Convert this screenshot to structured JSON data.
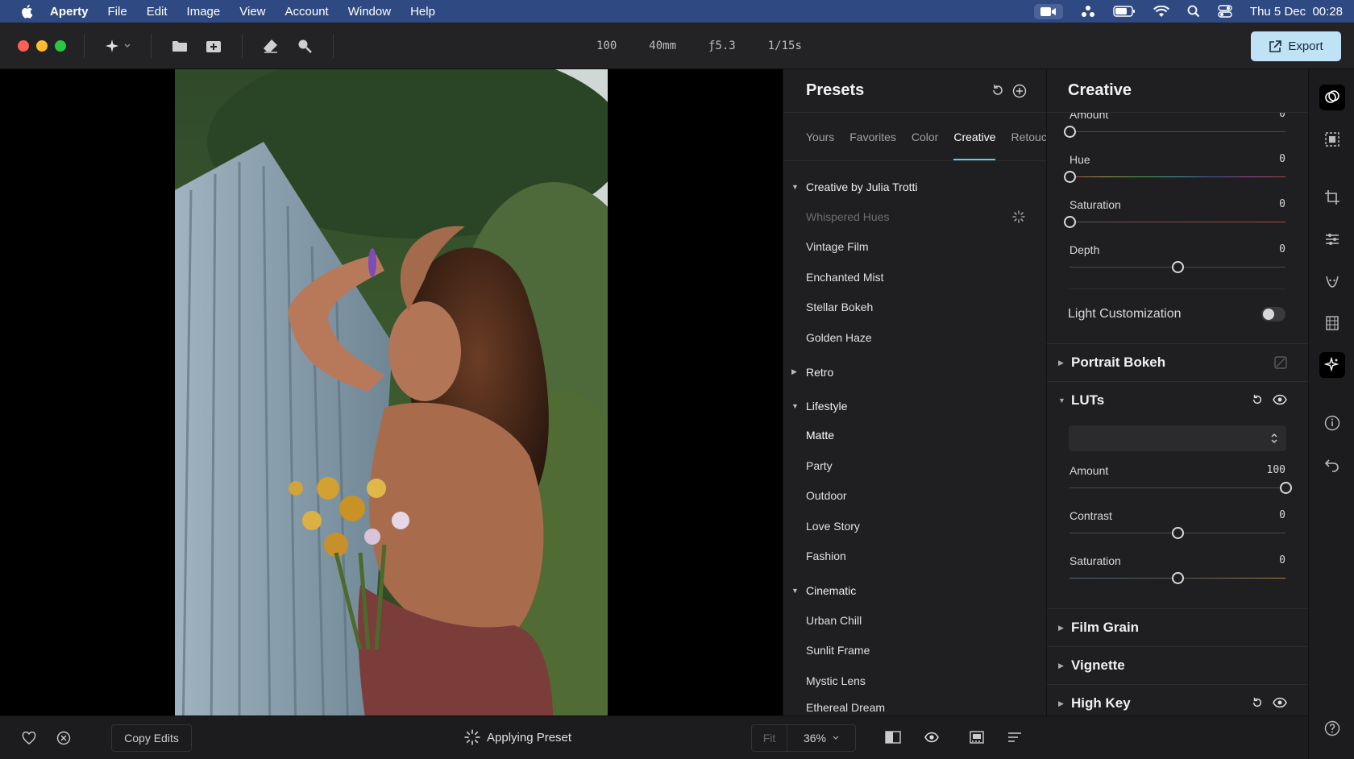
{
  "menubar": {
    "app_name": "Aperty",
    "items": [
      "File",
      "Edit",
      "Image",
      "View",
      "Account",
      "Window",
      "Help"
    ],
    "clock": "Thu 5 Dec  00:28"
  },
  "toolbar": {
    "meta": {
      "iso": "100",
      "focal": "40mm",
      "aperture": "ƒ5.3",
      "shutter": "1/15s"
    },
    "export_label": "Export"
  },
  "presets": {
    "title": "Presets",
    "tabs": [
      "Yours",
      "Favorites",
      "Color",
      "Creative",
      "Retouch"
    ],
    "active_tab": "Creative",
    "groups": [
      {
        "name": "Creative by Julia Trotti",
        "expanded": true,
        "items": [
          "Whispered Hues",
          "Vintage Film",
          "Enchanted Mist",
          "Stellar Bokeh",
          "Golden Haze"
        ]
      },
      {
        "name": "Retro",
        "expanded": false,
        "items": []
      },
      {
        "name": "Lifestyle",
        "expanded": true,
        "items": [
          "Matte",
          "Party",
          "Outdoor",
          "Love Story",
          "Fashion"
        ]
      },
      {
        "name": "Cinematic",
        "expanded": true,
        "items": [
          "Urban Chill",
          "Sunlit Frame",
          "Mystic Lens",
          "Ethereal Dream"
        ]
      }
    ],
    "loading_item": "Whispered Hues"
  },
  "creative_panel": {
    "title": "Creative",
    "top_sliders": [
      {
        "label": "Amount",
        "value": "0",
        "pos": 0
      },
      {
        "label": "Hue",
        "value": "0",
        "pos": 0
      },
      {
        "label": "Saturation",
        "value": "0",
        "pos": 0
      },
      {
        "label": "Depth",
        "value": "0",
        "pos": 0.5
      }
    ],
    "light_customization": {
      "label": "Light Customization",
      "enabled": false
    },
    "portrait_bokeh": "Portrait Bokeh",
    "luts": {
      "title": "LUTs",
      "select_value": "",
      "sliders": [
        {
          "label": "Amount",
          "value": "100",
          "pos": 1
        },
        {
          "label": "Contrast",
          "value": "0",
          "pos": 0.5
        },
        {
          "label": "Saturation",
          "value": "0",
          "pos": 0.5
        }
      ]
    },
    "film_grain": "Film Grain",
    "vignette": "Vignette",
    "high_key": "High Key"
  },
  "bottombar": {
    "copy_edits": "Copy Edits",
    "status": "Applying Preset",
    "fit": "Fit",
    "zoom": "36%"
  },
  "colors": {
    "accent": "#6fc3e8",
    "export_bg": "#bfe3f5",
    "menubar": "#2f4a82"
  }
}
